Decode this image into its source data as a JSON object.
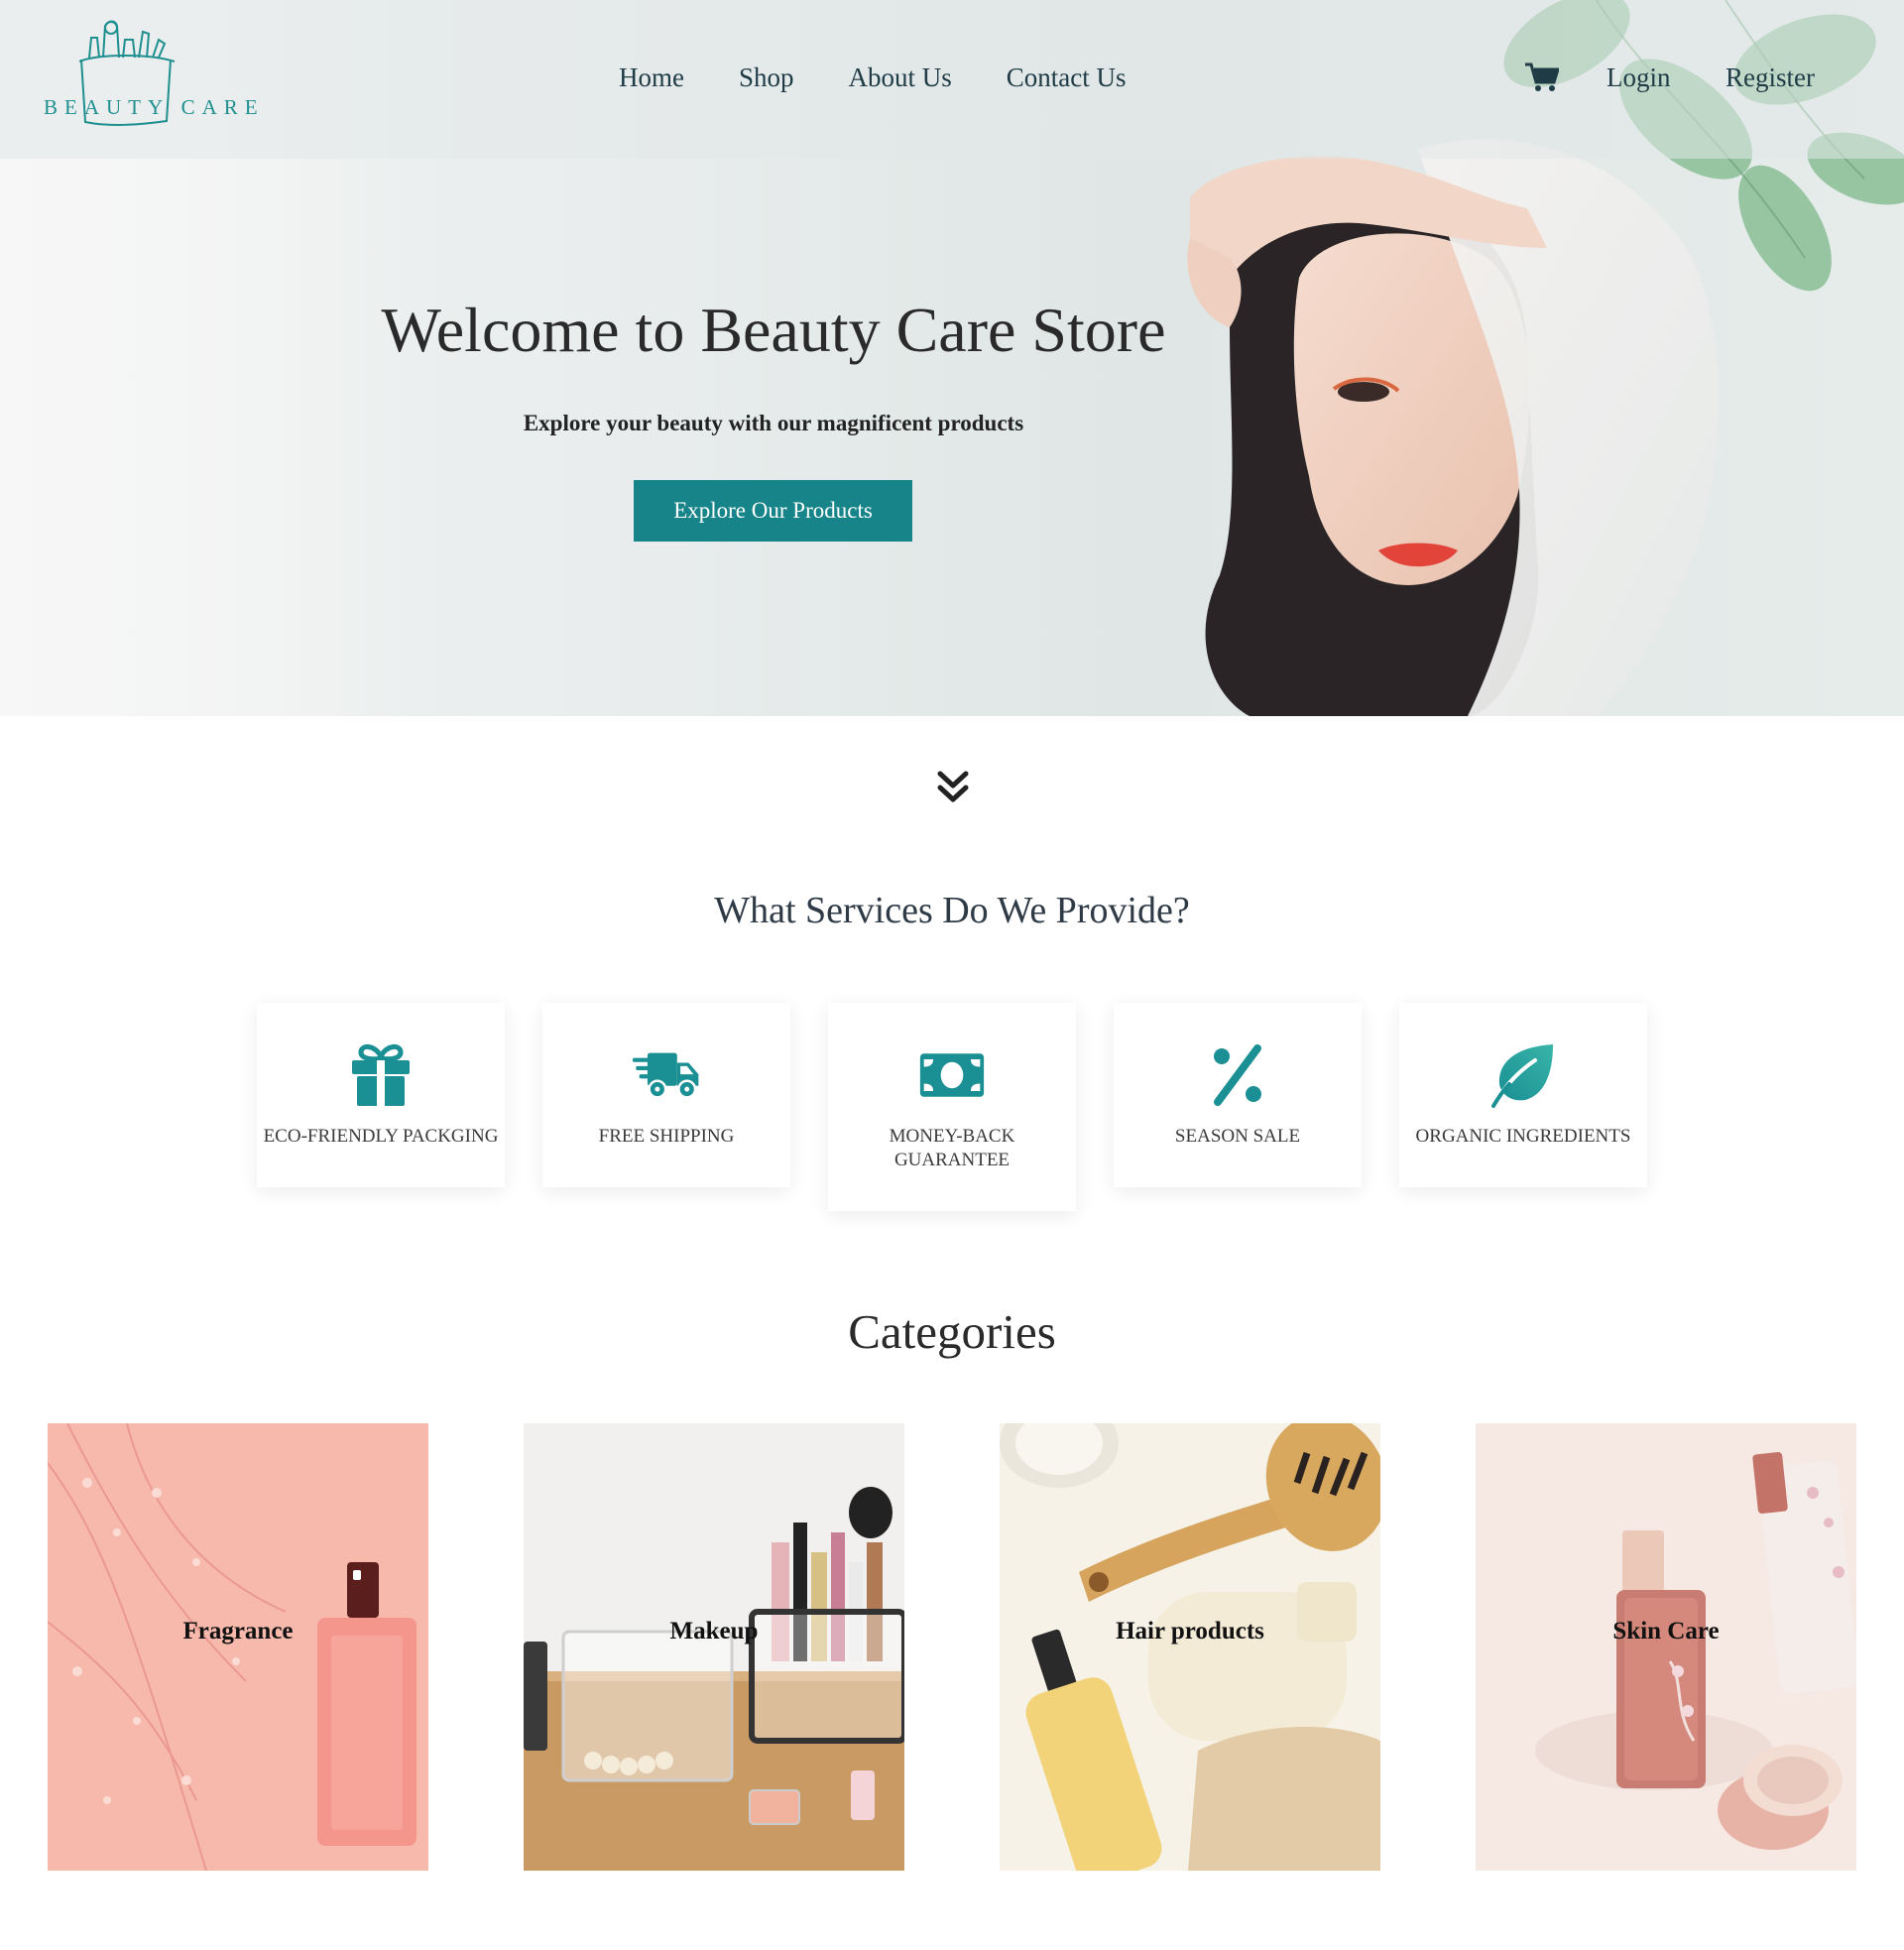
{
  "brand": {
    "logo_text": "BEAUTY CARE"
  },
  "nav": {
    "links": [
      "Home",
      "Shop",
      "About Us",
      "Contact Us"
    ],
    "login": "Login",
    "register": "Register"
  },
  "hero": {
    "title": "Welcome to Beauty Care Store",
    "subtitle": "Explore your beauty with our magnificent products",
    "cta": "Explore Our Products"
  },
  "services": {
    "title": "What Services Do We Provide?",
    "items": [
      {
        "label": "ECO-FRIENDLY PACKGING",
        "icon": "gift-icon"
      },
      {
        "label": "FREE SHIPPING",
        "icon": "truck-icon"
      },
      {
        "label": "MONEY-BACK GUARANTEE",
        "icon": "money-icon"
      },
      {
        "label": "SEASON SALE",
        "icon": "percent-icon"
      },
      {
        "label": "ORGANIC INGREDIENTS",
        "icon": "leaf-icon"
      }
    ]
  },
  "categories": {
    "title": "Categories",
    "items": [
      "Fragrance",
      "Makeup",
      "Hair products",
      "Skin Care"
    ]
  },
  "colors": {
    "accent": "#17848a",
    "nav_text": "#1e3b46",
    "icon": "#1a8f94"
  }
}
